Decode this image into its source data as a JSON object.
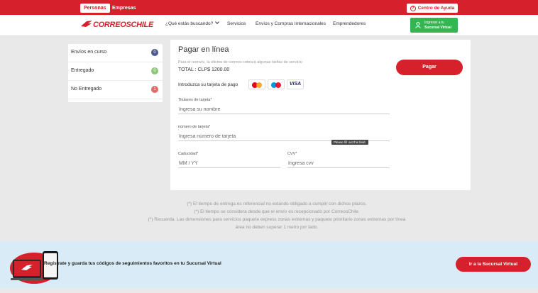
{
  "topbar": {
    "tab_personas": "Personas",
    "tab_empresas": "Empresas",
    "help_label": "Centro de Ayuda"
  },
  "nav": {
    "logo_text": "CORREOSCHILE",
    "items": [
      "¿Qué estás buscando?",
      "Servicios",
      "Envíos y Compras Internacionales",
      "Emprendedores"
    ],
    "sucursal_line1": "Ingresar a tu",
    "sucursal_line2": "Sucursal Virtual"
  },
  "status": {
    "items": [
      {
        "label": "Envíos en curso",
        "count": "0",
        "color": "#4a5a8c"
      },
      {
        "label": "Entregado",
        "count": "0",
        "color": "#8bc979"
      },
      {
        "label": "No Entregado",
        "count": "1",
        "color": "#e06a6a"
      }
    ]
  },
  "payment": {
    "title": "Pagar en línea",
    "note": "Para el reenvío, la oficina de correos cobrará algunas tarifas de servicio",
    "total": "TOTAL : CLP$ 1200.00",
    "pay_button": "Pagar",
    "card_prompt": "Introduzca su tarjeta de pago",
    "card_brands": [
      "mastercard-icon",
      "maestro-icon",
      "VISA"
    ],
    "holder_label": "Titulares de tarjeta*",
    "holder_placeholder": "Ingresa su nombre",
    "number_label": "número de tarjeta*",
    "number_placeholder": "Ingresa número de tarjeta",
    "tooltip": "Please fill out this field.",
    "expiry_label": "Caducidad*",
    "expiry_placeholder": "MM / YY",
    "cvv_label": "CVV*",
    "cvv_placeholder": "Ingresa cvv"
  },
  "disclaimers": {
    "line1": "(*) El tiempo de entrega es referencial no estando obligado a cumplir con dichos plazos.",
    "line2": "(*) El tiempo se considera desde que el envío es recepcionado por CorreosChile.",
    "line3": "(*) Recuerda. Las dimensiones para servicios paquete express zonas extremas y paquete prioritario zonas extremas  por línea",
    "line4": "área no deben superar 1 metro por lado."
  },
  "banner": {
    "text": "Regístrate y guarda tus códigos de seguimientos favoritos en tu Sucursal Virtual",
    "button": "Ir a la Sucursal Virtual"
  },
  "colors": {
    "brand_red": "#d6212c",
    "green": "#35b551",
    "banner_bg": "#d8ebf7"
  }
}
